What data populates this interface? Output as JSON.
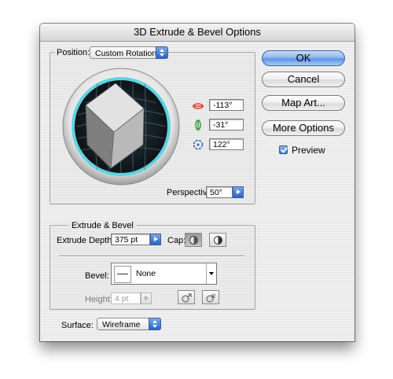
{
  "window": {
    "title": "3D Extrude & Bevel Options"
  },
  "position": {
    "label": "Position:",
    "selected": "Custom Rotation",
    "rotation_x": "-113°",
    "rotation_y": "-31°",
    "rotation_z": "122°",
    "perspective_label": "Perspective:",
    "perspective_value": "50°"
  },
  "extrude_bevel": {
    "group_label": "Extrude & Bevel",
    "depth_label": "Extrude Depth:",
    "depth_value": "375 pt",
    "cap_label": "Cap:",
    "bevel_label": "Bevel:",
    "bevel_value": "None",
    "height_label": "Height:",
    "height_value": "4 pt"
  },
  "surface": {
    "label": "Surface:",
    "selected": "Wireframe"
  },
  "buttons": {
    "ok": "OK",
    "cancel": "Cancel",
    "map_art": "Map Art...",
    "more_options": "More Options",
    "preview_label": "Preview",
    "preview_checked": true
  },
  "icons": {
    "rotate_x": "x-axis-rotation-icon",
    "rotate_y": "y-axis-rotation-icon",
    "rotate_z": "z-axis-rotation-icon"
  },
  "colors": {
    "accent": "#5e93e6",
    "track_ring": "#5fd3e0",
    "axis_x": "#d9402b",
    "axis_y": "#3a9a3a",
    "axis_z": "#2a5fc9"
  }
}
